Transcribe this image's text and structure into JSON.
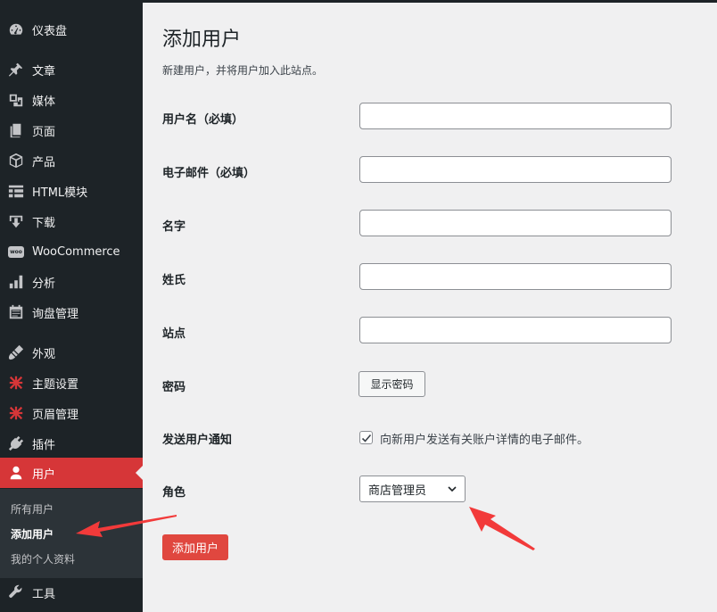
{
  "sidebar": {
    "items": [
      {
        "label": "仪表盘",
        "icon": "dashboard-icon"
      },
      {
        "label": "文章",
        "icon": "pin-icon"
      },
      {
        "label": "媒体",
        "icon": "media-icon"
      },
      {
        "label": "页面",
        "icon": "page-icon"
      },
      {
        "label": "产品",
        "icon": "box-icon"
      },
      {
        "label": "HTML模块",
        "icon": "layout-icon"
      },
      {
        "label": "下载",
        "icon": "download-icon"
      },
      {
        "label": "WooCommerce",
        "icon": "woo-icon"
      },
      {
        "label": "分析",
        "icon": "bar-chart-icon"
      },
      {
        "label": "询盘管理",
        "icon": "calendar-icon"
      },
      {
        "label": "外观",
        "icon": "brush-icon"
      },
      {
        "label": "主题设置",
        "icon": "theme-icon"
      },
      {
        "label": "页眉管理",
        "icon": "header-icon"
      },
      {
        "label": "插件",
        "icon": "plugin-icon"
      },
      {
        "label": "用户",
        "icon": "user-icon"
      },
      {
        "label": "工具",
        "icon": "wrench-icon"
      }
    ],
    "submenu": [
      {
        "label": "所有用户"
      },
      {
        "label": "添加用户"
      },
      {
        "label": "我的个人资料"
      }
    ],
    "woo_badge": "woo"
  },
  "page": {
    "title": "添加用户",
    "description": "新建用户，并将用户加入此站点。"
  },
  "form": {
    "username_label": "用户名（必填）",
    "email_label": "电子邮件（必填）",
    "first_name_label": "名字",
    "last_name_label": "姓氏",
    "website_label": "站点",
    "password_label": "密码",
    "show_password_button": "显示密码",
    "notify_label": "发送用户通知",
    "notify_checkbox_label": "向新用户发送有关账户详情的电子邮件。",
    "notify_checked": true,
    "role_label": "角色",
    "role_value": "商店管理员",
    "submit_button": "添加用户"
  },
  "colors": {
    "accent": "#d63638",
    "button_primary": "#e0473f",
    "sidebar_bg": "#1d2327"
  }
}
